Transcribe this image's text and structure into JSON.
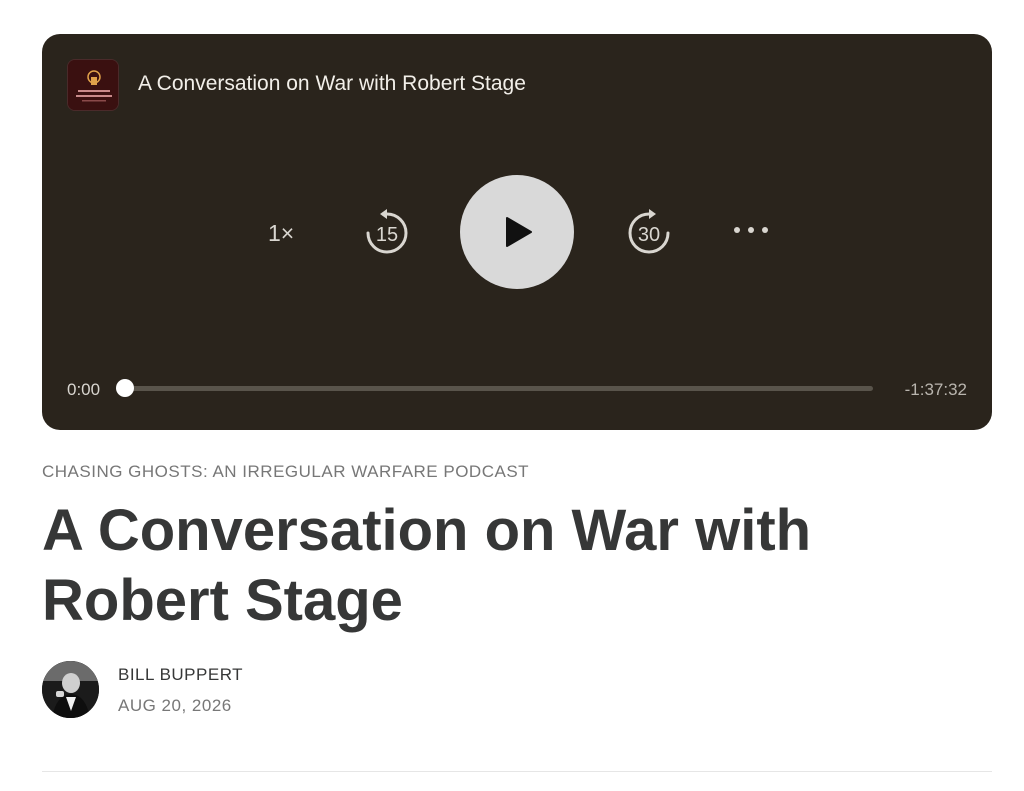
{
  "player": {
    "episode_title": "A Conversation on War with Robert Stage",
    "artwork_icon": "podcast-artwork",
    "speed_label": "1×",
    "skip_back_label": "15",
    "skip_forward_label": "30",
    "play_icon": "play-icon",
    "more_icon": "more-icon",
    "current_time": "0:00",
    "remaining_time": "-1:37:32",
    "progress": 0
  },
  "post": {
    "kicker": "CHASING GHOSTS: AN IRREGULAR WARFARE PODCAST",
    "title": "A Conversation on War with Robert Stage",
    "author": "BILL BUPPERT",
    "date": "AUG 20, 2026"
  },
  "colors": {
    "player_bg": "#2a241c",
    "text_dark": "#363737",
    "text_muted": "#777777"
  }
}
